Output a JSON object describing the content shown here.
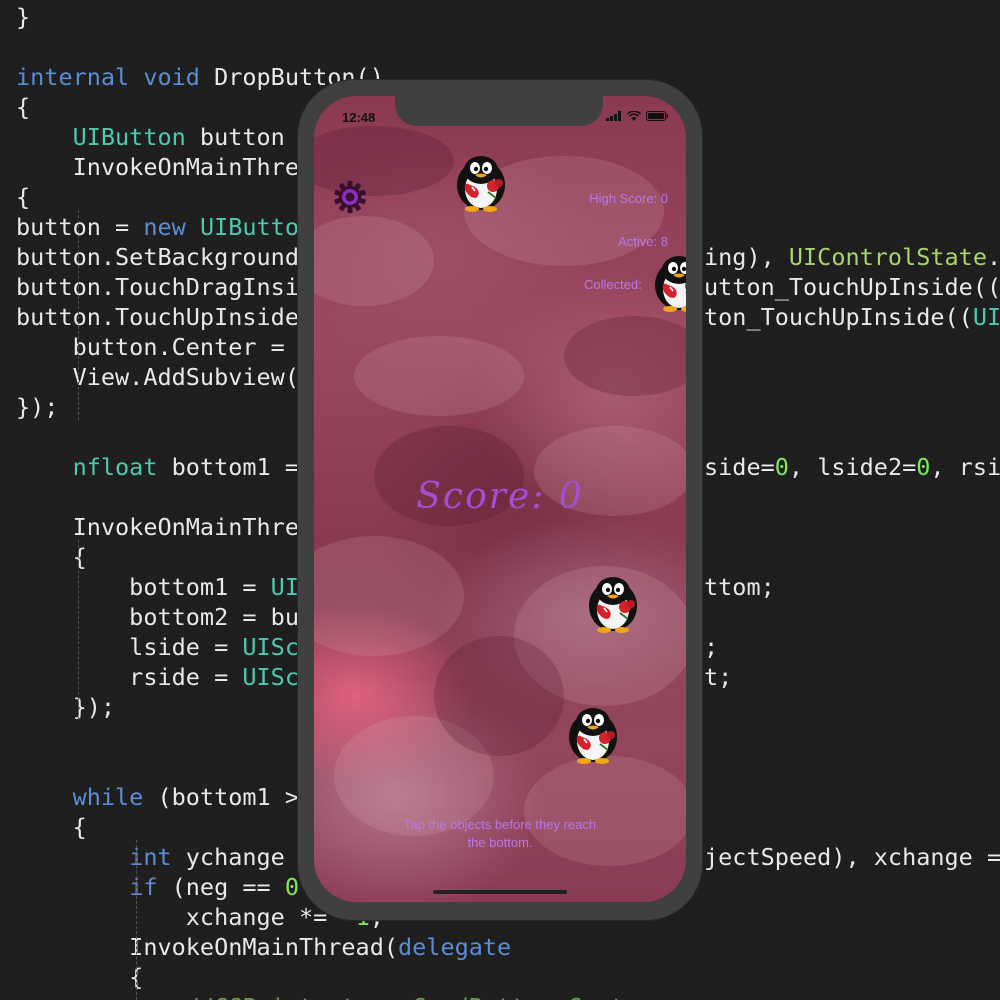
{
  "code": {
    "lines": [
      [
        {
          "t": "}",
          "c": "t-plain"
        }
      ],
      [],
      [
        {
          "t": "internal void ",
          "c": "t-kw"
        },
        {
          "t": "DropButton()",
          "c": "t-plain"
        }
      ],
      [
        {
          "t": "{",
          "c": "t-plain"
        }
      ],
      [
        {
          "t": "    ",
          "c": "t-plain"
        },
        {
          "t": "UIButton",
          "c": "t-type"
        },
        {
          "t": " button ",
          "c": "t-plain"
        }
      ],
      [
        {
          "t": "    InvokeOnMainThre",
          "c": "t-plain"
        }
      ],
      [
        {
          "t": "{",
          "c": "t-plain"
        }
      ],
      [
        {
          "t": "button = ",
          "c": "t-plain"
        },
        {
          "t": "new ",
          "c": "t-kw"
        },
        {
          "t": "UIButto",
          "c": "t-type"
        }
      ],
      [
        {
          "t": "button.SetBackground",
          "c": "t-plain"
        }
      ],
      [
        {
          "t": "button.TouchDragInsi",
          "c": "t-plain"
        }
      ],
      [
        {
          "t": "button.TouchUpInside",
          "c": "t-plain"
        }
      ],
      [
        {
          "t": "    button.Center = ",
          "c": "t-plain"
        }
      ],
      [
        {
          "t": "    View.AddSubview(",
          "c": "t-plain"
        }
      ],
      [
        {
          "t": "});",
          "c": "t-plain"
        }
      ],
      [],
      [
        {
          "t": "    ",
          "c": "t-plain"
        },
        {
          "t": "nfloat",
          "c": "t-type"
        },
        {
          "t": " bottom1 = ",
          "c": "t-plain"
        }
      ],
      [],
      [
        {
          "t": "    InvokeOnMainThre",
          "c": "t-plain"
        }
      ],
      [
        {
          "t": "    {",
          "c": "t-plain"
        }
      ],
      [
        {
          "t": "        bottom1 = ",
          "c": "t-plain"
        },
        {
          "t": "UI",
          "c": "t-type"
        }
      ],
      [
        {
          "t": "        bottom2 = bu",
          "c": "t-plain"
        }
      ],
      [
        {
          "t": "        lside = ",
          "c": "t-plain"
        },
        {
          "t": "UISc",
          "c": "t-type"
        }
      ],
      [
        {
          "t": "        rside = ",
          "c": "t-plain"
        },
        {
          "t": "UISc",
          "c": "t-type"
        }
      ],
      [
        {
          "t": "    });",
          "c": "t-plain"
        }
      ],
      [],
      [],
      [
        {
          "t": "    ",
          "c": "t-plain"
        },
        {
          "t": "while",
          "c": "t-kw"
        },
        {
          "t": " (bottom1 >",
          "c": "t-plain"
        }
      ],
      [
        {
          "t": "    {",
          "c": "t-plain"
        }
      ],
      [
        {
          "t": "        ",
          "c": "t-plain"
        },
        {
          "t": "int",
          "c": "t-kw"
        },
        {
          "t": " ychange ",
          "c": "t-plain"
        }
      ],
      [
        {
          "t": "        ",
          "c": "t-plain"
        },
        {
          "t": "if",
          "c": "t-kw"
        },
        {
          "t": " (neg == ",
          "c": "t-plain"
        },
        {
          "t": "0",
          "c": "t-num"
        }
      ],
      [
        {
          "t": "            xchange *= -",
          "c": "t-plain"
        },
        {
          "t": "1",
          "c": "t-num"
        },
        {
          "t": ";",
          "c": "t-plain"
        }
      ],
      [
        {
          "t": "        InvokeOnMainThread(",
          "c": "t-plain"
        },
        {
          "t": "delegate",
          "c": "t-kw"
        }
      ],
      [
        {
          "t": "        {",
          "c": "t-plain"
        }
      ],
      [
        {
          "t": "            //CGPoint ptr = CardButton.Center",
          "c": "t-cmt"
        }
      ]
    ],
    "right_lines": [
      {
        "row": 8,
        "segs": [
          {
            "t": "ing), ",
            "c": "t-plain"
          },
          {
            "t": "UIControlState",
            "c": "t-lt"
          },
          {
            "t": ".N",
            "c": "t-plain"
          }
        ]
      },
      {
        "row": 9,
        "segs": [
          {
            "t": "utton_TouchUpInside((",
            "c": "t-plain"
          },
          {
            "t": "U",
            "c": "t-type"
          }
        ]
      },
      {
        "row": 10,
        "segs": [
          {
            "t": "ton_TouchUpInside((",
            "c": "t-plain"
          },
          {
            "t": "UIB",
            "c": "t-type"
          }
        ]
      },
      {
        "row": 15,
        "segs": [
          {
            "t": "side=",
            "c": "t-plain"
          },
          {
            "t": "0",
            "c": "t-num"
          },
          {
            "t": ", lside2=",
            "c": "t-plain"
          },
          {
            "t": "0",
            "c": "t-num"
          },
          {
            "t": ", rsid",
            "c": "t-plain"
          }
        ]
      },
      {
        "row": 19,
        "segs": [
          {
            "t": "ttom;",
            "c": "t-plain"
          }
        ]
      },
      {
        "row": 21,
        "segs": [
          {
            "t": ";",
            "c": "t-plain"
          }
        ]
      },
      {
        "row": 22,
        "segs": [
          {
            "t": "t;",
            "c": "t-plain"
          }
        ]
      },
      {
        "row": 28,
        "segs": [
          {
            "t": "jectSpeed), xchange =",
            "c": "t-plain"
          }
        ]
      }
    ]
  },
  "status_bar": {
    "time": "12:48",
    "icons": [
      "signal-icon",
      "wifi-icon",
      "battery-icon"
    ]
  },
  "hud": {
    "high_score": "High Score: 0",
    "active": "Active: 8",
    "collected": "Collected: "
  },
  "score": "Score: 0",
  "instruction": "Tap the objects before they reach the bottom.",
  "settings_icon": "gear-icon",
  "objects": {
    "icon": "penguin-holding-heart-icon",
    "count_visible": 4
  },
  "colors": {
    "hud_text": "#b978e8",
    "score_text": "#a44fd6",
    "gear": "#8a2fc2",
    "phone_frame": "#404040",
    "code_bg": "#1f1f1f"
  }
}
